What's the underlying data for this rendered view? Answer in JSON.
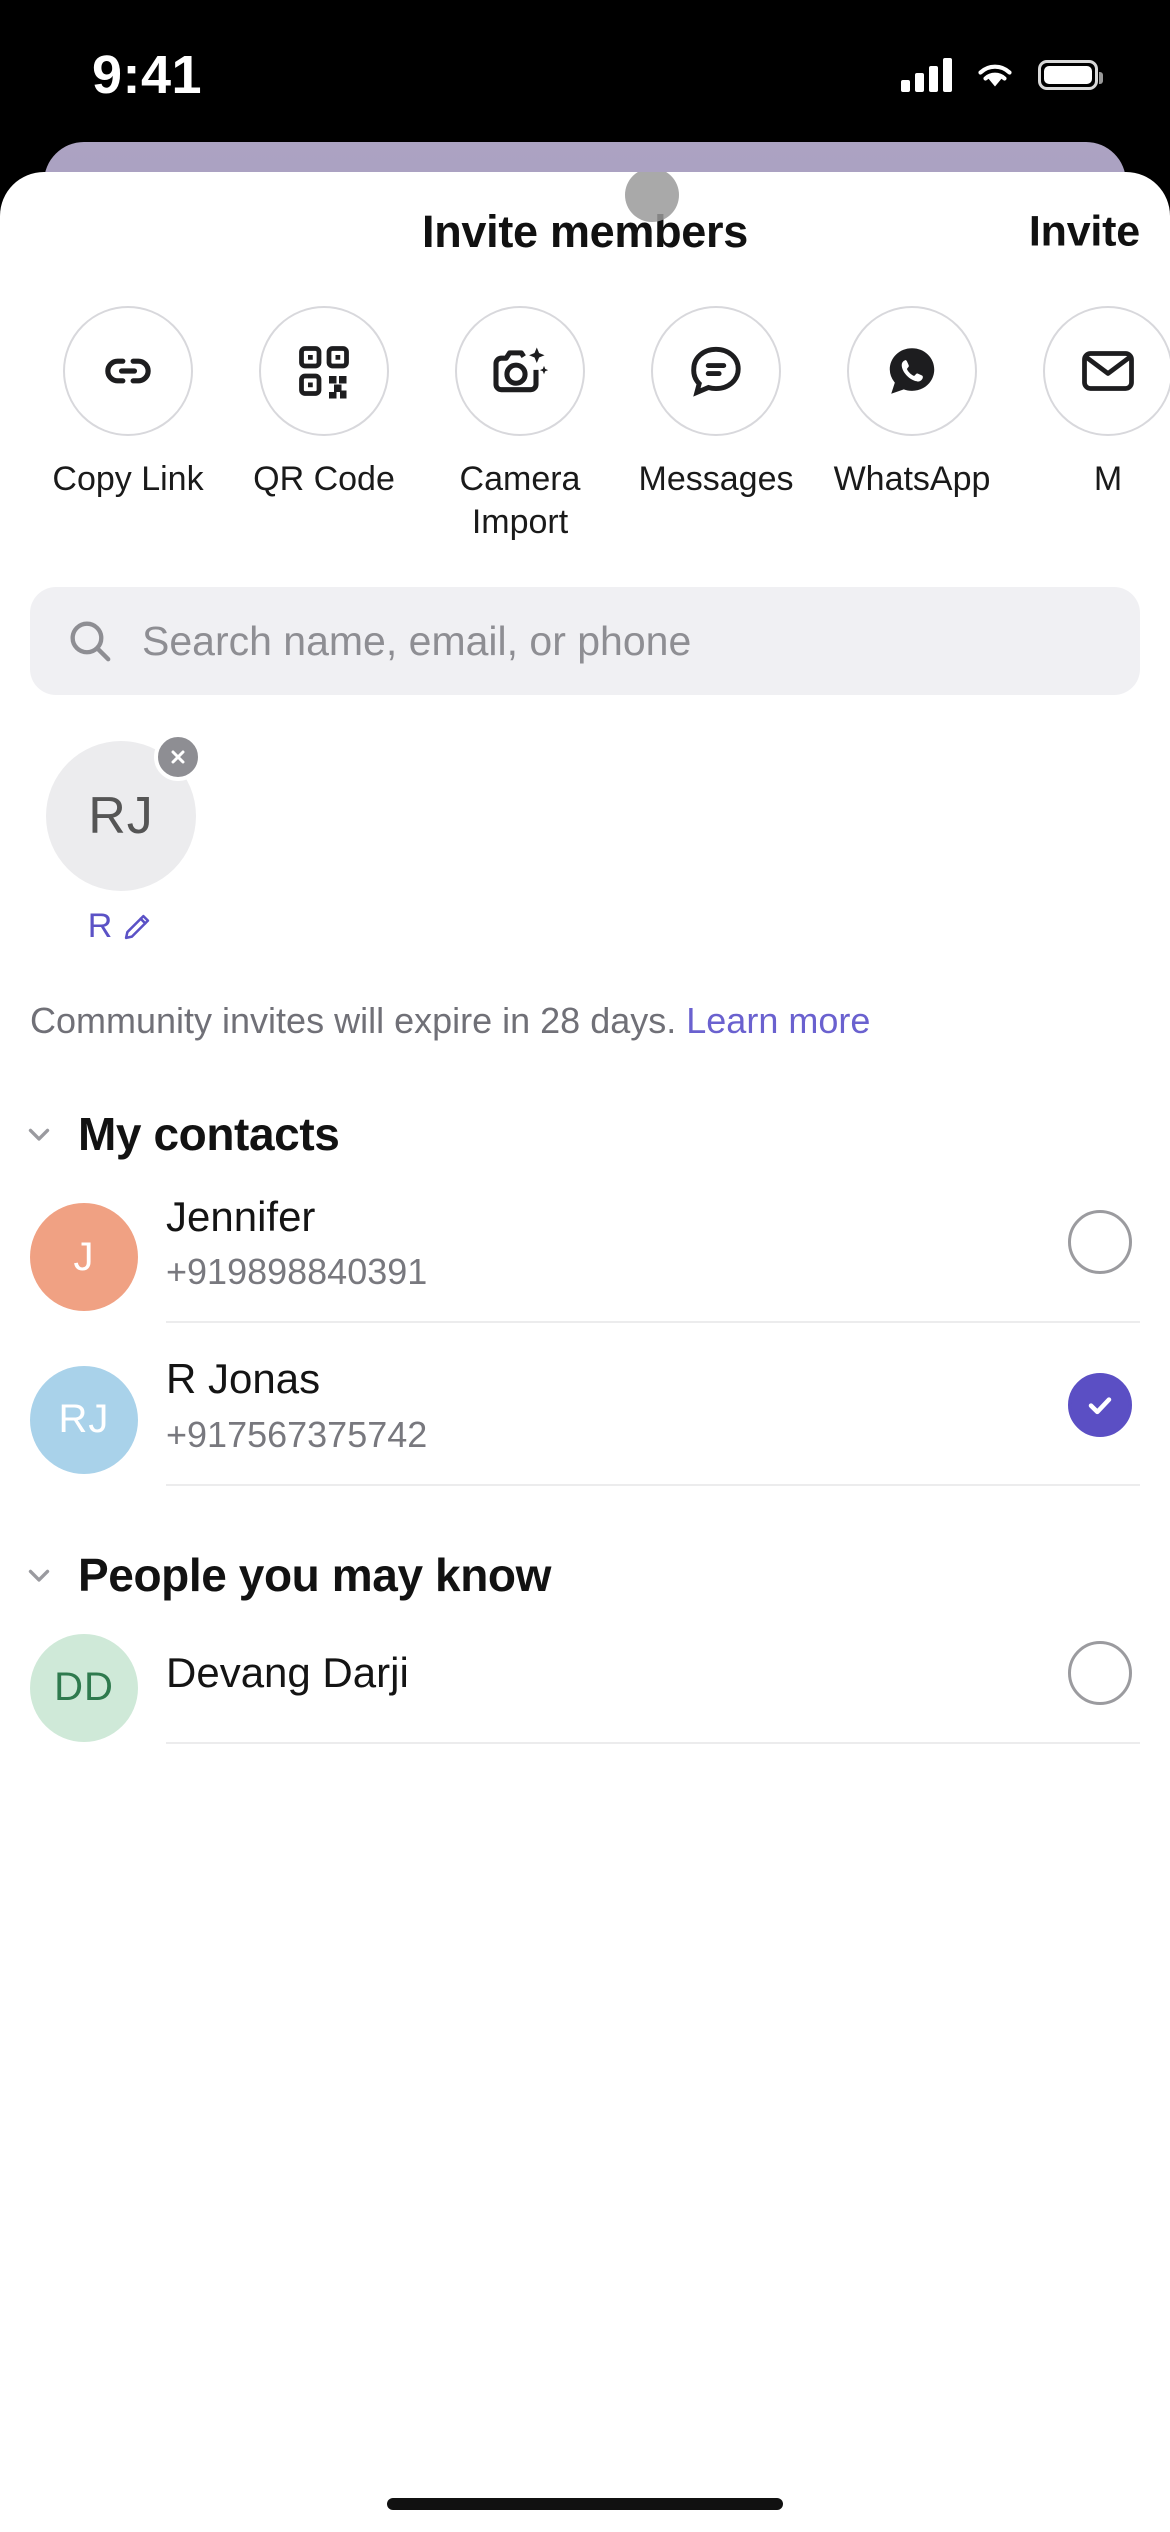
{
  "status_bar": {
    "time": "9:41",
    "signal_icon": "cellular-bars-icon",
    "wifi_icon": "wifi-icon",
    "battery_icon": "battery-icon"
  },
  "header": {
    "title": "Invite members",
    "action_label": "Invite"
  },
  "share_options": [
    {
      "label": "Copy Link",
      "icon": "link-icon"
    },
    {
      "label": "QR Code",
      "icon": "qr-code-icon"
    },
    {
      "label": "Camera Import",
      "icon": "camera-sparkle-icon"
    },
    {
      "label": "Messages",
      "icon": "message-bubble-icon"
    },
    {
      "label": "WhatsApp",
      "icon": "whatsapp-icon"
    },
    {
      "label": "M",
      "icon": "mail-icon"
    }
  ],
  "search": {
    "placeholder": "Search name, email, or phone",
    "value": "",
    "icon": "search-icon"
  },
  "selected_chips": [
    {
      "initials": "RJ",
      "name": "R",
      "remove_icon": "close-icon",
      "edit_icon": "pencil-icon"
    }
  ],
  "expiry_note": {
    "text": "Community invites will expire in 28 days.",
    "link": "Learn more"
  },
  "sections": [
    {
      "title": "My contacts",
      "chevron_icon": "chevron-down-icon",
      "contacts": [
        {
          "name": "Jennifer",
          "phone": "+919898840391",
          "initials": "J",
          "avatar_bg": "#f0a183",
          "avatar_fg": "#ffffff",
          "selected": false
        },
        {
          "name": "R Jonas",
          "phone": "+917567375742",
          "initials": "RJ",
          "avatar_bg": "#a9d2ea",
          "avatar_fg": "#ffffff",
          "selected": true
        }
      ]
    },
    {
      "title": "People you may know",
      "chevron_icon": "chevron-down-icon",
      "contacts": [
        {
          "name": "Devang Darji",
          "phone": "",
          "initials": "DD",
          "avatar_bg": "#cfe9d8",
          "avatar_fg": "#2f7a4e",
          "selected": false
        }
      ]
    }
  ],
  "colors": {
    "accent": "#5b4fc4",
    "link": "#6a61cf",
    "sheet_bg": "#ffffff",
    "backdrop_card": "#a79ec0",
    "search_bg": "#f0f0f3"
  }
}
